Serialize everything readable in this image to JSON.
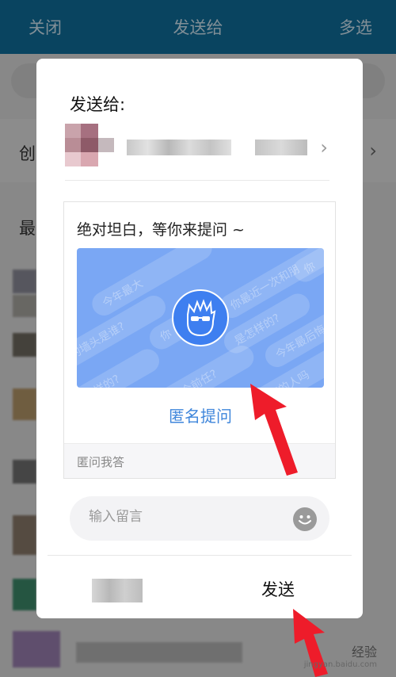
{
  "topbar": {
    "left": "关闭",
    "title": "发送给",
    "right": "多选"
  },
  "background": {
    "create_label": "创",
    "recent_label": "最"
  },
  "dialog": {
    "title": "发送给:",
    "card": {
      "title": "绝对坦白，等你来提问 ~",
      "banner_phrases": [
        "今年最大",
        "你最近一次和朋",
        "你",
        "的墙头是谁?",
        "你",
        "是怎样的?",
        "今年最后悔",
        "怎样的?",
        "几个前任?",
        "暗恋的人吗"
      ],
      "anon_button": "匿名提问",
      "footer": "匿问我答"
    },
    "message": {
      "placeholder": "输入留言"
    },
    "send_label": "发送"
  },
  "watermark": {
    "line1": "经验",
    "line2": "jingyan.baidu.com"
  },
  "colors": {
    "topbar": "#0f6e9c",
    "banner": "#7aa7f4",
    "link": "#3f86db",
    "arrow": "#ee1c2a"
  }
}
